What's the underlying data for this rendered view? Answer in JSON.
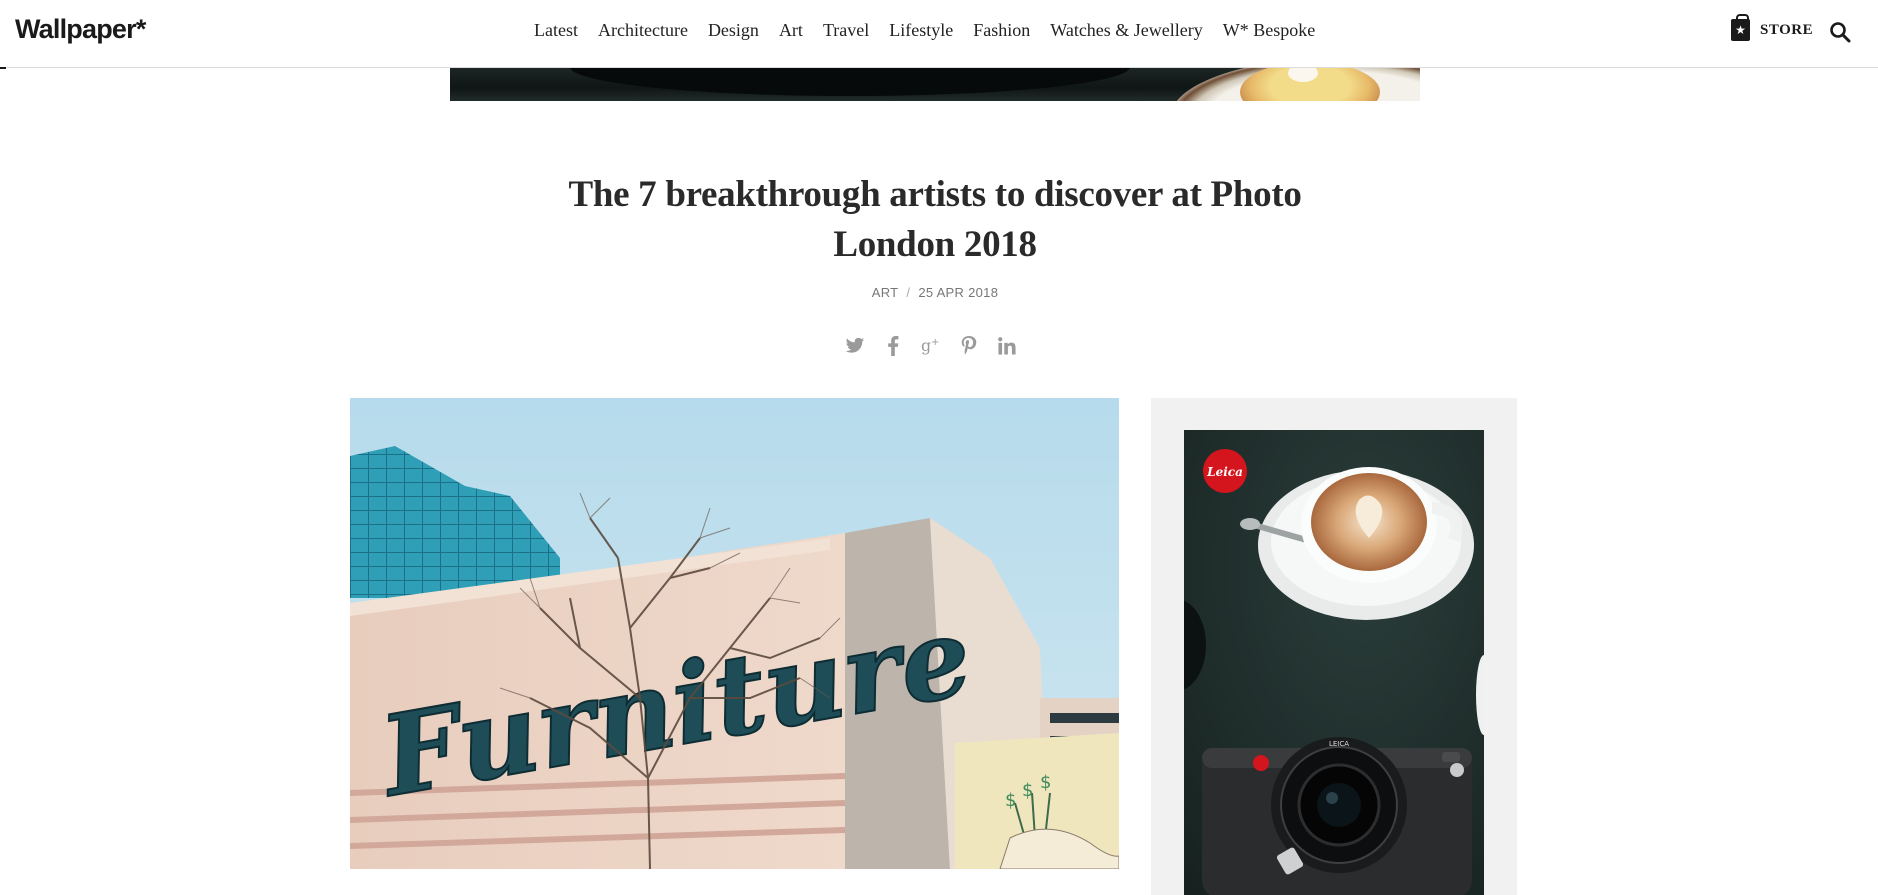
{
  "header": {
    "logo": "Wallpaper*",
    "nav": [
      {
        "label": "Latest"
      },
      {
        "label": "Architecture"
      },
      {
        "label": "Design"
      },
      {
        "label": "Art"
      },
      {
        "label": "Travel"
      },
      {
        "label": "Lifestyle"
      },
      {
        "label": "Fashion"
      },
      {
        "label": "Watches & Jewellery"
      },
      {
        "label": "W* Bespoke"
      }
    ],
    "store_label": "STORE",
    "store_icon": "shopping-bag-icon",
    "search_icon": "search-icon"
  },
  "article": {
    "title": "The 7 breakthrough artists to discover at Photo London 2018",
    "category": "ART",
    "separator": "/",
    "date": "25 APR 2018",
    "social": [
      "twitter-icon",
      "facebook-icon",
      "google-plus-icon",
      "pinterest-icon",
      "linkedin-icon"
    ],
    "photo_sign_text": "Furniture"
  },
  "ad": {
    "brand_badge": "Leica",
    "camera_lens_text": "LEICA"
  },
  "colors": {
    "text": "#222222",
    "meta": "#777777",
    "icon": "#999999",
    "sidebar_bg": "#f1f1f1",
    "leica_red": "#d4151d"
  }
}
